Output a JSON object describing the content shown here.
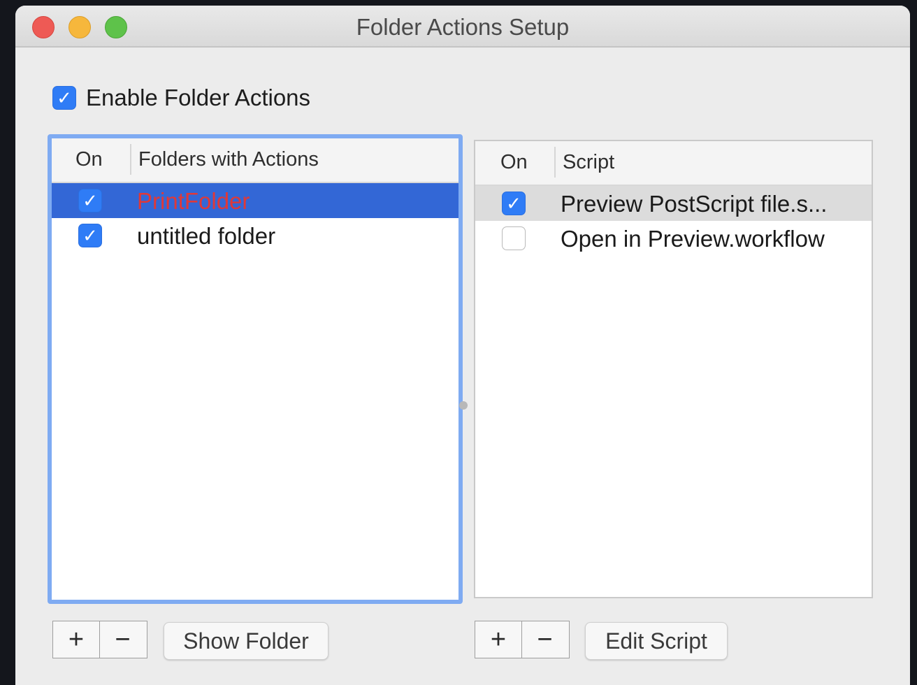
{
  "window": {
    "title": "Folder Actions Setup"
  },
  "enable": {
    "label": "Enable Folder Actions",
    "checked": true
  },
  "folders_table": {
    "columns": [
      "On",
      "Folders with Actions"
    ],
    "rows": [
      {
        "on": true,
        "name": "PrintFolder",
        "selected": true
      },
      {
        "on": true,
        "name": "untitled folder",
        "selected": false
      }
    ]
  },
  "scripts_table": {
    "columns": [
      "On",
      "Script"
    ],
    "rows": [
      {
        "on": true,
        "name": "Preview PostScript file.s...",
        "selected": true
      },
      {
        "on": false,
        "name": "Open in Preview.workflow",
        "selected": false
      }
    ]
  },
  "buttons": {
    "add": "+",
    "remove": "−",
    "show_folder": "Show Folder",
    "edit_script": "Edit Script"
  },
  "icons": {
    "checkmark": "✓",
    "close": "close-icon",
    "minimize": "minimize-icon",
    "zoom": "zoom-icon"
  },
  "colors": {
    "accent": "#2f7cf6",
    "selection": "#3367d6",
    "selected_text": "#e03838"
  }
}
